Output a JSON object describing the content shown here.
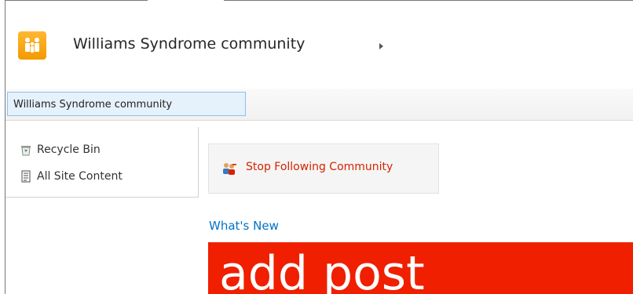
{
  "header": {
    "site_title": "Williams Syndrome community"
  },
  "top_nav": {
    "items": [
      {
        "label": "Williams Syndrome community"
      }
    ]
  },
  "quick_launch": {
    "items": [
      {
        "label": "Recycle Bin",
        "icon": "recycle-bin-icon"
      },
      {
        "label": "All Site Content",
        "icon": "site-content-icon"
      }
    ]
  },
  "main": {
    "follow_button": {
      "label": "Stop Following Community",
      "icon": "people-follow-icon"
    },
    "whats_new_heading": "What's New",
    "add_post_tile": {
      "label": "add post"
    }
  },
  "colors": {
    "accent_blue": "#0072c6",
    "tile_red": "#f01f00",
    "follow_text": "#d62300",
    "logo_orange": "#f39a00"
  }
}
